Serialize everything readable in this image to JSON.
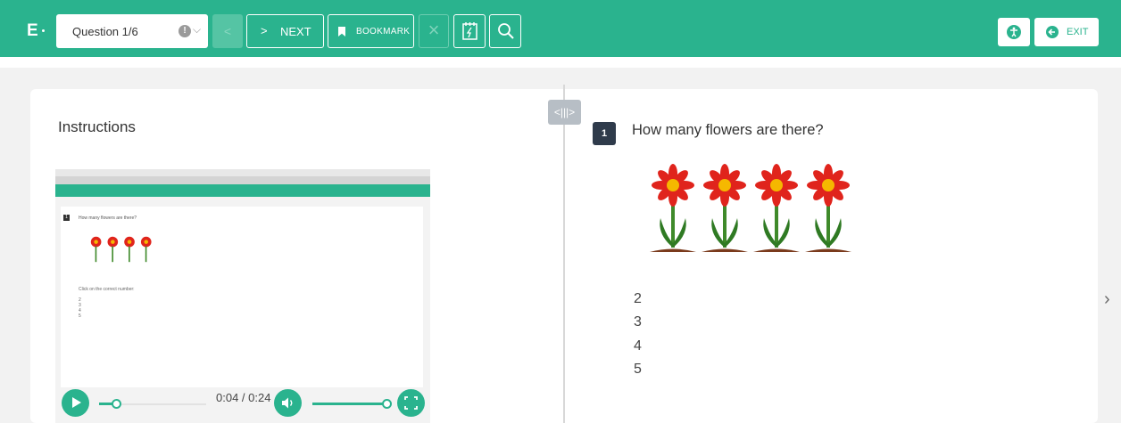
{
  "header": {
    "logo": "E",
    "question_select": "Question 1/6",
    "prev_label": "<",
    "next_label": "NEXT",
    "bookmark_label": "BOOKMARK",
    "exit_label": "EXIT"
  },
  "left": {
    "heading": "Instructions",
    "video": {
      "time": "0:04 / 0:24",
      "progress_fraction": 0.17,
      "volume_fraction": 1.0,
      "inner_question": "How many flowers are there?",
      "inner_instruction": "Click on the correct number:",
      "inner_options": [
        "2",
        "3",
        "4",
        "5"
      ]
    }
  },
  "right": {
    "question_number": "1",
    "question_text": "How many flowers are there?",
    "options": [
      "2",
      "3",
      "4",
      "5"
    ]
  },
  "colors": {
    "accent": "#2ab38e",
    "badge": "#2f3b4b",
    "flower_petal": "#e0241c",
    "flower_center": "#f5b800"
  }
}
